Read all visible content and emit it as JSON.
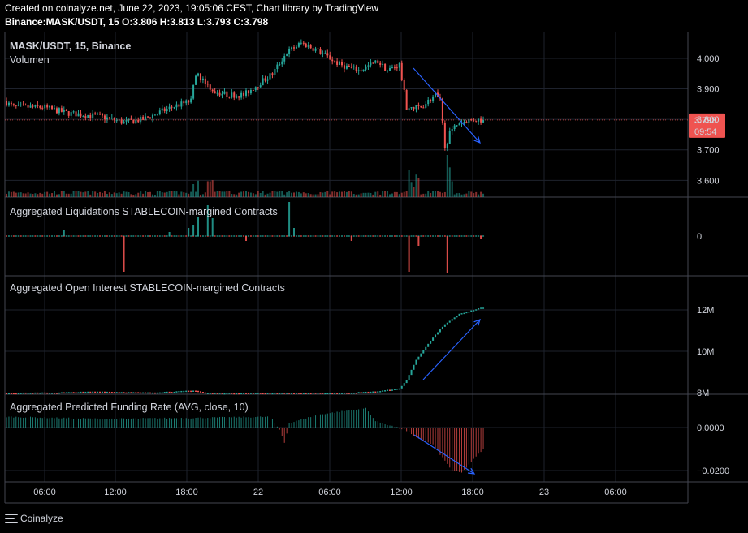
{
  "header": {
    "line1": "Created on coinalyze.net, June 22, 2023, 19:05:06 CEST, Chart library by TradingView",
    "line2": "Binance:MASK/USDT, 15 O:3.806 H:3.813 L:3.793 C:3.798"
  },
  "footer": {
    "brand": "Coinalyze"
  },
  "colors": {
    "up": "#26a69a",
    "down": "#ef5350",
    "arrow": "#2962ff",
    "grid": "#1e222d",
    "price_badge": "#ef5350"
  },
  "price_badge": {
    "price": "3.798",
    "countdown": "09:54"
  },
  "chart_data": [
    {
      "type": "candlestick",
      "title": "MASK/USDT, 15, Binance",
      "subtitle": "Volumen",
      "y_ticks": [
        "4.000",
        "3.900",
        "3.800",
        "3.700",
        "3.600"
      ],
      "y_tick_values": [
        4.0,
        3.9,
        3.8,
        3.7,
        3.6
      ],
      "y_range": [
        3.545,
        4.085
      ],
      "last_price": 3.798,
      "price_anchors": [
        [
          0,
          3.86
        ],
        [
          4,
          3.84
        ],
        [
          16,
          3.84
        ],
        [
          27,
          3.82
        ],
        [
          40,
          3.81
        ],
        [
          50,
          3.79
        ],
        [
          58,
          3.8
        ],
        [
          70,
          3.84
        ],
        [
          78,
          3.86
        ],
        [
          80,
          3.95
        ],
        [
          84,
          3.92
        ],
        [
          88,
          3.89
        ],
        [
          94,
          3.88
        ],
        [
          100,
          3.88
        ],
        [
          112,
          3.95
        ],
        [
          118,
          4.02
        ],
        [
          124,
          4.05
        ],
        [
          130,
          4.03
        ],
        [
          136,
          4.0
        ],
        [
          140,
          3.98
        ],
        [
          148,
          3.96
        ],
        [
          156,
          3.99
        ],
        [
          160,
          3.96
        ],
        [
          165,
          3.98
        ],
        [
          168,
          3.84
        ],
        [
          174,
          3.84
        ],
        [
          180,
          3.88
        ],
        [
          182,
          3.86
        ],
        [
          184,
          3.7
        ],
        [
          186,
          3.76
        ],
        [
          190,
          3.79
        ],
        [
          196,
          3.8
        ],
        [
          199,
          3.798
        ]
      ],
      "x_ticks": [
        "06:00",
        "12:00",
        "18:00",
        "22",
        "06:00",
        "12:00",
        "18:00",
        "23",
        "06:00"
      ]
    },
    {
      "type": "bar",
      "title": "Aggregated Liquidations STABLECOIN-margined Contracts",
      "y_ticks": [
        "0"
      ]
    },
    {
      "type": "line",
      "title": "Aggregated Open Interest STABLECOIN-margined Contracts",
      "y_ticks": [
        "12M",
        "10M",
        "8M"
      ],
      "y_tick_values": [
        12,
        10,
        8
      ],
      "oi_anchors": [
        [
          0,
          7.98
        ],
        [
          20,
          8.0
        ],
        [
          40,
          8.05
        ],
        [
          60,
          8.0
        ],
        [
          80,
          8.1
        ],
        [
          84,
          7.98
        ],
        [
          100,
          7.98
        ],
        [
          140,
          7.98
        ],
        [
          155,
          8.05
        ],
        [
          165,
          8.2
        ],
        [
          168,
          8.6
        ],
        [
          172,
          9.6
        ],
        [
          176,
          10.2
        ],
        [
          180,
          10.8
        ],
        [
          184,
          11.3
        ],
        [
          190,
          11.8
        ],
        [
          199,
          12.1
        ]
      ]
    },
    {
      "type": "bar",
      "title": "Aggregated Predicted Funding Rate (AVG, close, 10)",
      "y_ticks": [
        "0.0000",
        "−0.0200"
      ],
      "y_tick_values": [
        0,
        -0.02
      ],
      "funding_anchors": [
        [
          0,
          0.005
        ],
        [
          40,
          0.004
        ],
        [
          80,
          0.0045
        ],
        [
          110,
          0.005
        ],
        [
          114,
          -0.001
        ],
        [
          116,
          -0.007
        ],
        [
          118,
          0.002
        ],
        [
          130,
          0.006
        ],
        [
          150,
          0.009
        ],
        [
          154,
          0.003
        ],
        [
          166,
          -0.001
        ],
        [
          170,
          -0.004
        ],
        [
          178,
          -0.008
        ],
        [
          186,
          -0.02
        ],
        [
          190,
          -0.021
        ],
        [
          194,
          -0.016
        ],
        [
          199,
          -0.01
        ]
      ]
    }
  ]
}
